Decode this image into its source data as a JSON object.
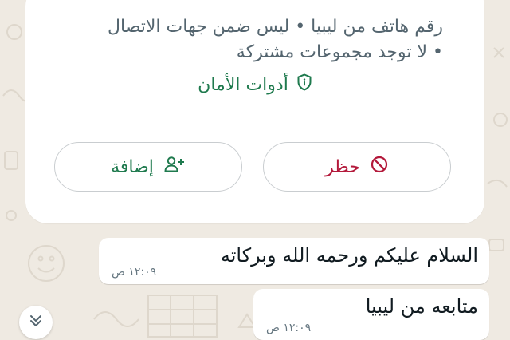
{
  "contact_card": {
    "info_line_1": "رقم هاتف من ليبيا • ليس ضمن جهات الاتصال",
    "info_line_2": "• لا توجد مجموعات مشتركة",
    "safety_tools_label": "أدوات الأمان",
    "block_label": "حظر",
    "add_label": "إضافة"
  },
  "messages": [
    {
      "text": "السلام عليكم ورحمه الله وبركاته",
      "time": "١٢:٠٩ ص"
    },
    {
      "text": "متابعه من ليبيا",
      "time": "١٢:٠٩ ص"
    }
  ],
  "icons": {
    "safety": "shield-icon",
    "block": "block-icon",
    "add": "add-contact-icon",
    "scroll": "double-chevron-down-icon"
  },
  "colors": {
    "background": "#efeae2",
    "card": "#ffffff",
    "accent_green": "#1f7a4e",
    "block_red": "#b3183a",
    "secondary_text": "#54656f"
  }
}
